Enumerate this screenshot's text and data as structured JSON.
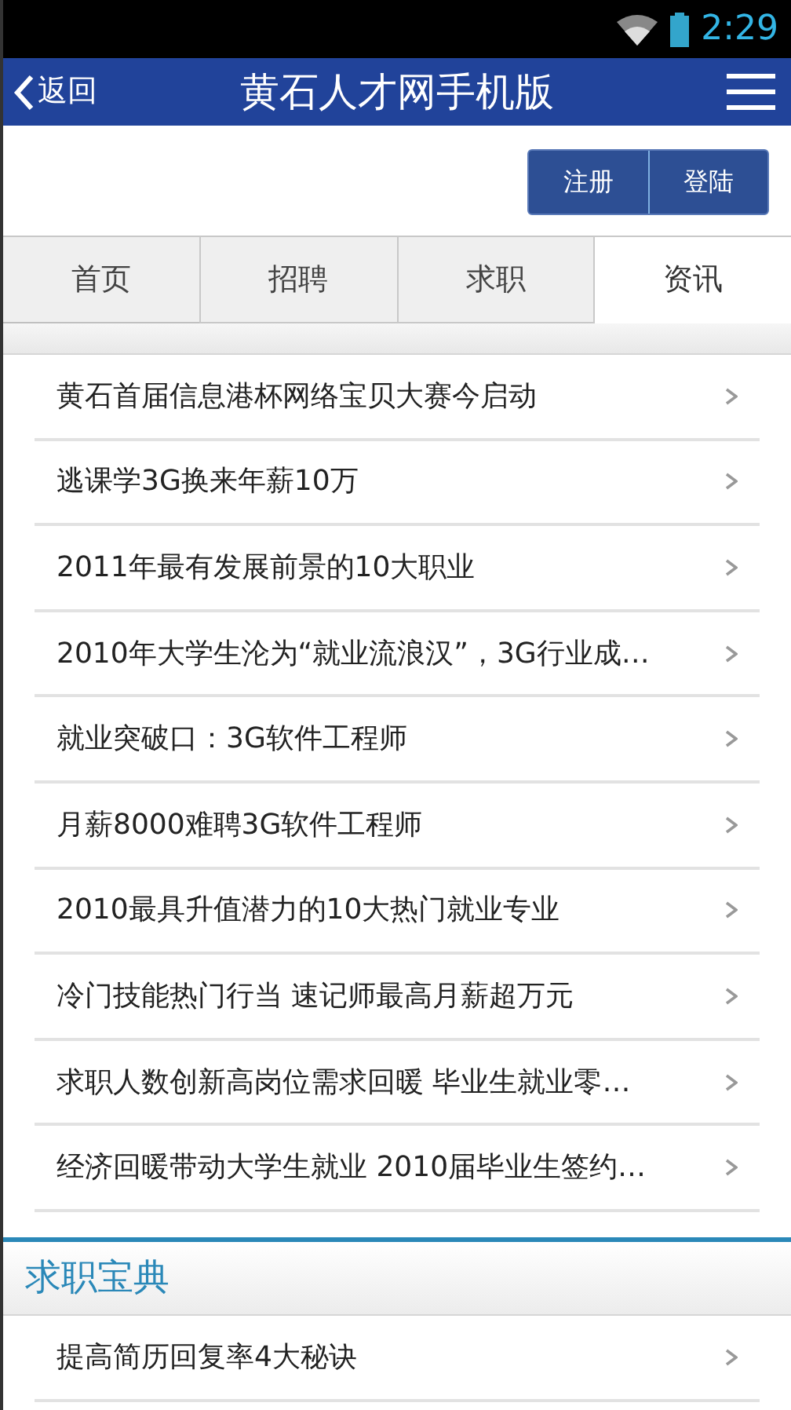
{
  "status_bar": {
    "time": "2:29"
  },
  "header": {
    "back": "返回",
    "title": "黄石人才网手机版"
  },
  "account_buttons": [
    "注册",
    "登陆"
  ],
  "tabs": [
    {
      "label": "首页",
      "selected": false
    },
    {
      "label": "招聘",
      "selected": false
    },
    {
      "label": "求职",
      "selected": false
    },
    {
      "label": "资讯",
      "selected": true
    }
  ],
  "sections": [
    {
      "items": [
        "黄石首届信息港杯网络宝贝大赛今启动",
        "逃课学3G换来年薪10万",
        "2011年最有发展前景的10大职业",
        "2010年大学生沦为“就业流浪汉”，3G行业成…",
        "就业突破口：3G软件工程师",
        "月薪8000难聘3G软件工程师",
        "2010最具升值潜力的10大热门就业专业",
        "冷门技能热门行当 速记师最高月薪超万元",
        "求职人数创新高岗位需求回暖 毕业生就业零…",
        "经济回暖带动大学生就业 2010届毕业生签约…"
      ]
    },
    {
      "title": "求职宝典",
      "items": [
        "提高简历回复率4大秘诀"
      ]
    }
  ]
}
